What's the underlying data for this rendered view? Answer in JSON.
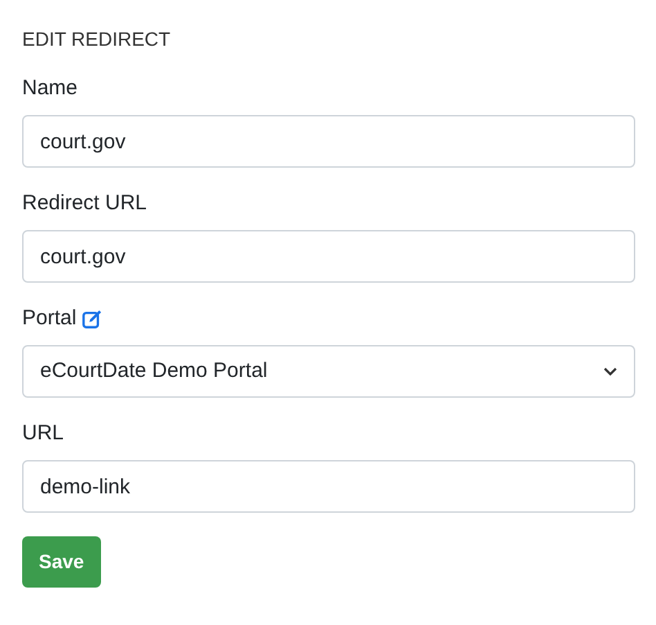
{
  "heading": "EDIT REDIRECT",
  "fields": [
    {
      "kind": "text",
      "label": "Name",
      "value": "court.gov"
    },
    {
      "kind": "text",
      "label": "Redirect URL",
      "value": "court.gov"
    },
    {
      "kind": "select",
      "label": "Portal",
      "value": "eCourtDate Demo Portal",
      "edit_link": true
    },
    {
      "kind": "text",
      "label": "URL",
      "value": "demo-link"
    }
  ],
  "save_button": "Save"
}
